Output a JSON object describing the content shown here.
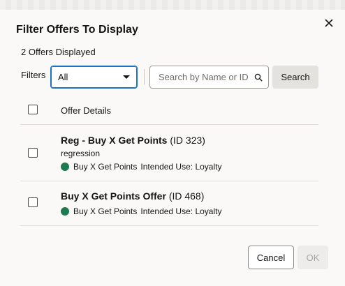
{
  "dialog": {
    "title": "Filter Offers To Display",
    "close_icon": "close-icon",
    "subtitle": "2 Offers Displayed"
  },
  "filters": {
    "label": "Filters",
    "selected": "All",
    "search_placeholder": "Search by Name or ID",
    "search_value": "",
    "search_button": "Search"
  },
  "table": {
    "header": "Offer Details",
    "rows": [
      {
        "name": "Reg - Buy X Get Points",
        "id_text": "(ID 323)",
        "description": "regression",
        "type": "Buy X Get Points",
        "intended_use": "Intended Use: Loyalty",
        "checked": false,
        "status_color": "#1e7b4f"
      },
      {
        "name": "Buy X Get Points Offer",
        "id_text": "(ID 468)",
        "type": "Buy X Get Points",
        "intended_use": "Intended Use: Loyalty",
        "checked": false,
        "status_color": "#1e7b4f"
      }
    ]
  },
  "footer": {
    "cancel": "Cancel",
    "ok": "OK"
  },
  "colors": {
    "accent": "#1a73c6",
    "status_active": "#1e7b4f"
  }
}
